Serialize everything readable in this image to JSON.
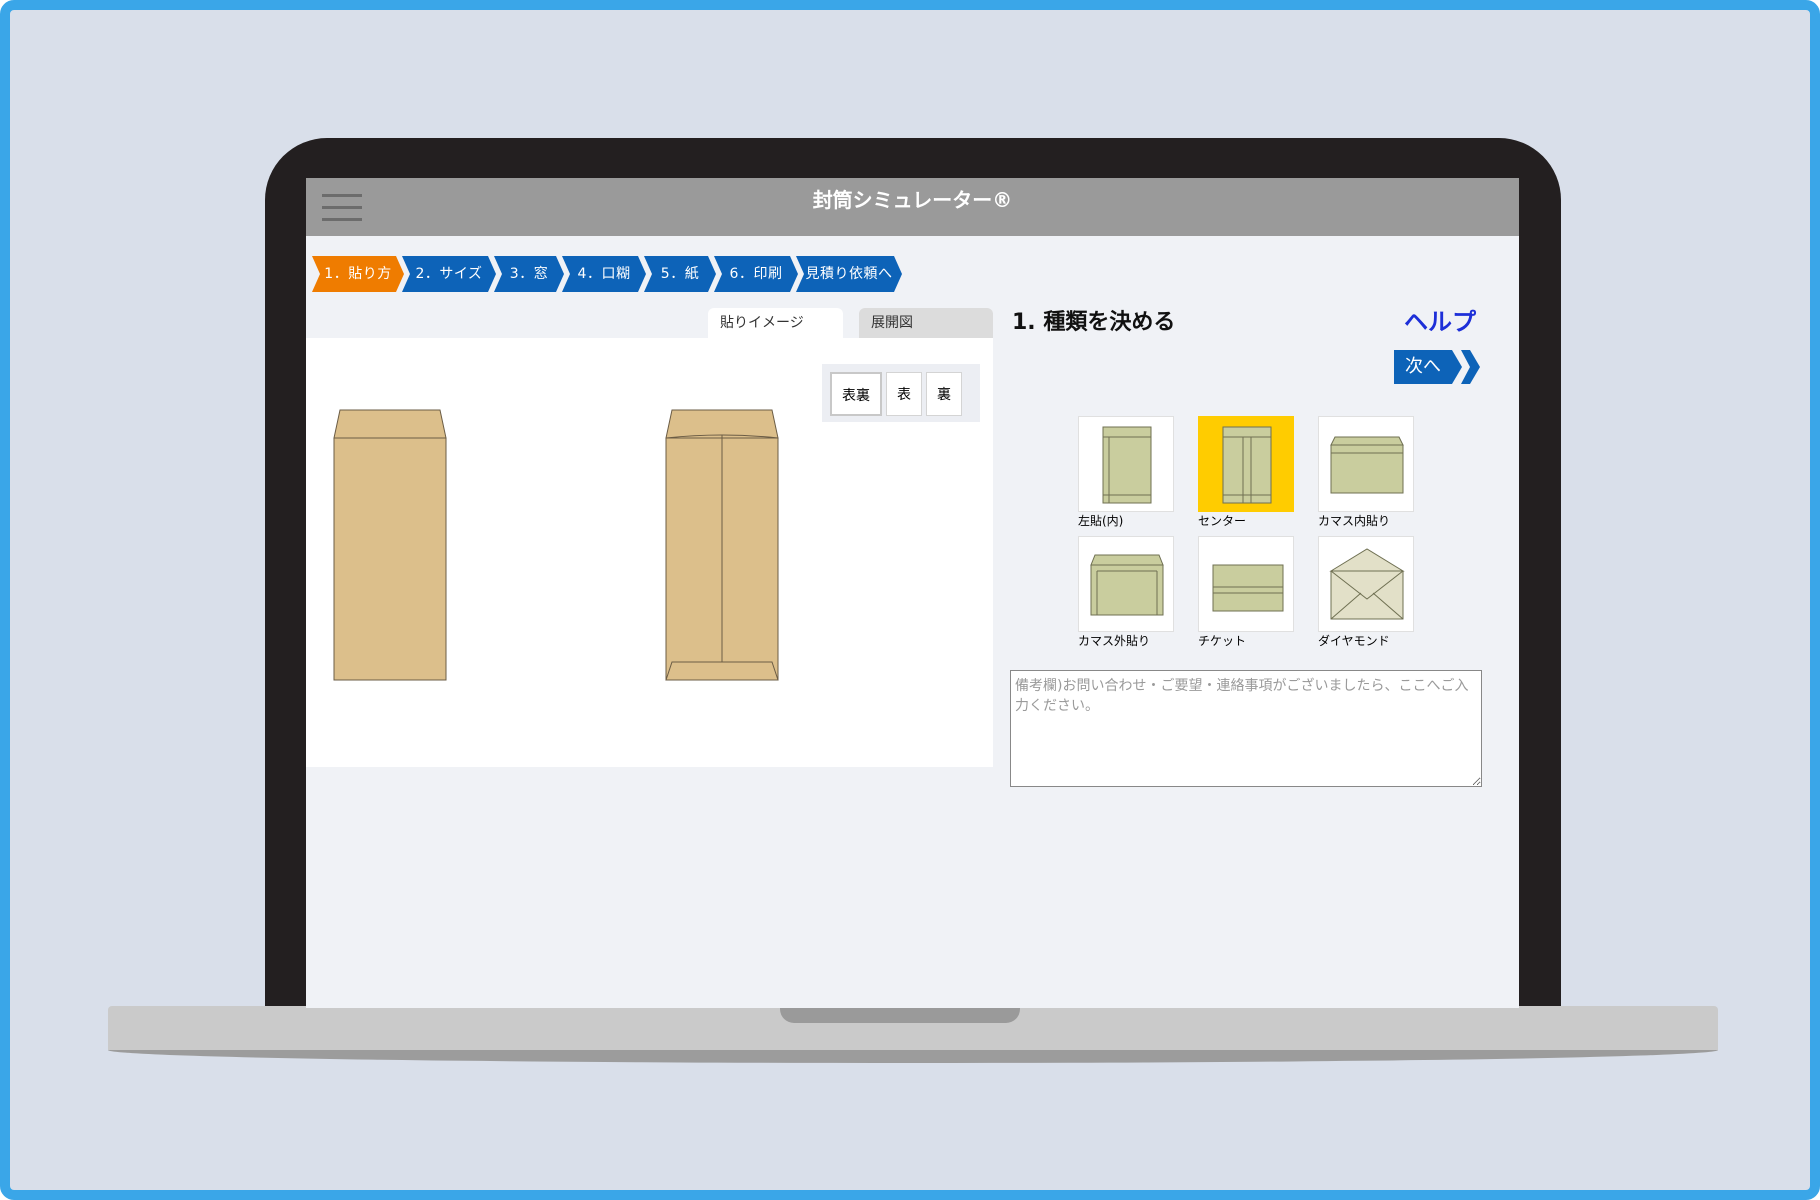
{
  "app": {
    "title": "封筒シミュレーター®"
  },
  "steps": [
    {
      "label": "1．貼り方",
      "active": true
    },
    {
      "label": "2．サイズ",
      "active": false
    },
    {
      "label": "3．窓",
      "active": false
    },
    {
      "label": "4．口糊",
      "active": false
    },
    {
      "label": "5．紙",
      "active": false
    },
    {
      "label": "6．印刷",
      "active": false
    },
    {
      "label": "見積り依頼へ",
      "active": false
    }
  ],
  "preview": {
    "tabs": {
      "image": "貼りイメージ",
      "development": "展開図"
    },
    "toggles": {
      "both": "表裏",
      "front": "表",
      "back": "裏"
    },
    "selected_toggle": "表裏"
  },
  "section": {
    "title": "1.  種類を決める",
    "help": "ヘルプ",
    "next": "次へ"
  },
  "types": [
    {
      "label": "左貼(内)",
      "icon": "left-seam-envelope-icon",
      "selected": false
    },
    {
      "label": "センター",
      "icon": "center-seam-envelope-icon",
      "selected": true
    },
    {
      "label": "カマス内貼り",
      "icon": "kamasu-inner-envelope-icon",
      "selected": false
    },
    {
      "label": "カマス外貼り",
      "icon": "kamasu-outer-envelope-icon",
      "selected": false
    },
    {
      "label": "チケット",
      "icon": "ticket-envelope-icon",
      "selected": false
    },
    {
      "label": "ダイヤモンド",
      "icon": "diamond-envelope-icon",
      "selected": false
    }
  ],
  "notes": {
    "placeholder": "備考欄)お問い合わせ・ご要望・連絡事項がございましたら、ここへご入力ください。",
    "value": ""
  },
  "colors": {
    "active_step": "#ef7c00",
    "step": "#0d63b8",
    "selected_type": "#ffcc00",
    "envelope": "#dcbf8b",
    "envelope_icon": "#c9cd9e",
    "help_link": "#1d2fd8"
  }
}
